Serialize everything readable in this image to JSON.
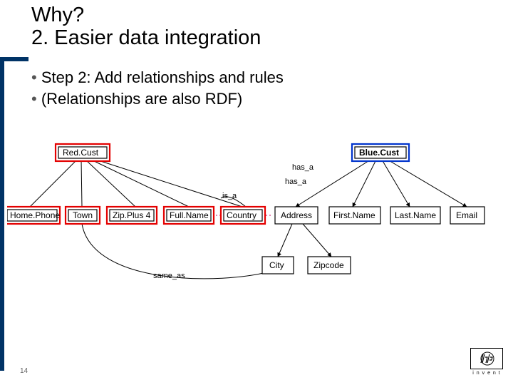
{
  "title": {
    "line1": "Why?",
    "line2": "2. Easier data integration"
  },
  "bullets": [
    "Step 2: Add relationships and rules",
    "(Relationships are also RDF)"
  ],
  "page_number": "14",
  "logo": {
    "brand": "hp",
    "tagline": "i n v e n t"
  },
  "diagram": {
    "nodes": {
      "red_cust": {
        "label": "Red.Cust",
        "style": "red"
      },
      "blue_cust": {
        "label": "Blue.Cust",
        "style": "blue"
      },
      "home_phone": {
        "label": "Home.Phone",
        "style": "plain"
      },
      "town": {
        "label": "Town",
        "style": "plain"
      },
      "zip_plus4": {
        "label": "Zip.Plus 4",
        "style": "plain"
      },
      "full_name": {
        "label": "Full.Name",
        "style": "plain"
      },
      "country": {
        "label": "Country",
        "style": "plain"
      },
      "address": {
        "label": "Address",
        "style": "plain"
      },
      "first_name": {
        "label": "First.Name",
        "style": "plain"
      },
      "last_name": {
        "label": "Last.Name",
        "style": "plain"
      },
      "email": {
        "label": "Email",
        "style": "plain"
      },
      "city": {
        "label": "City",
        "style": "plain"
      },
      "zipcode": {
        "label": "Zipcode",
        "style": "plain"
      }
    },
    "edge_labels": {
      "has_a_1": "has_a",
      "has_a_2": "has_a",
      "is_a": "is_a",
      "same_as": "same_as"
    }
  }
}
